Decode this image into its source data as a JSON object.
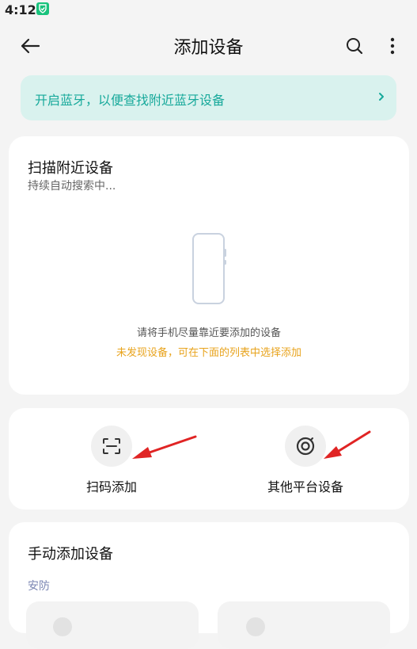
{
  "status_bar": {
    "time": "4:12",
    "app_icon": "shield-check-icon"
  },
  "header": {
    "title": "添加设备",
    "back_icon": "arrow-left-icon",
    "search_icon": "search-icon",
    "more_icon": "more-vertical-icon"
  },
  "bluetooth_banner": {
    "text": "开启蓝牙，以便查找附近蓝牙设备",
    "icon": "chevron-right-icon",
    "accent_color": "#17a99b"
  },
  "scan_section": {
    "title": "扫描附近设备",
    "subtitle": "持续自动搜索中...",
    "illustration": "phone-outline-icon",
    "hint": "请将手机尽量靠近要添加的设备",
    "warning": "未发现设备，可在下面的列表中选择添加",
    "warning_color": "#e8a31c"
  },
  "actions": [
    {
      "label": "扫码添加",
      "icon": "scan-qr-icon"
    },
    {
      "label": "其他平台设备",
      "icon": "platform-ring-icon"
    }
  ],
  "manual_section": {
    "title": "手动添加设备",
    "category": "安防",
    "tile_icons": [
      "device-icon",
      "device-icon"
    ]
  }
}
